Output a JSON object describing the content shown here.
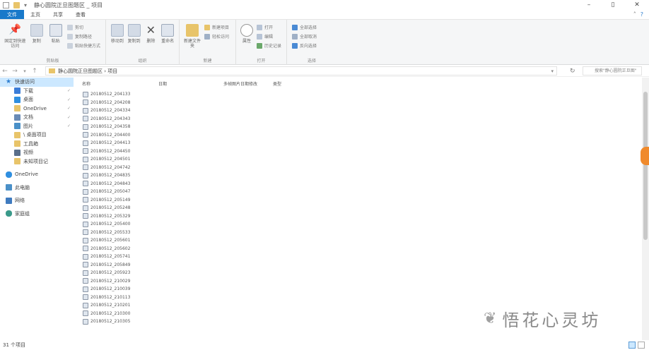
{
  "titlebar": {
    "title": "静心圆院正旦图题区 _ 项目",
    "controls": [
      "–",
      "▯",
      "✕"
    ]
  },
  "ribbon_tabs": [
    {
      "label": "文件",
      "active": true
    },
    {
      "label": "主页"
    },
    {
      "label": "共享"
    },
    {
      "label": "查看"
    }
  ],
  "ribbon": {
    "clipboard": {
      "label": "剪贴板",
      "pin_label": "固定到快速访问",
      "copy_label": "复制",
      "paste_label": "粘贴",
      "cut_label": "剪切",
      "copy_path_label": "复制路径",
      "paste_shortcut_label": "粘贴快捷方式"
    },
    "organize": {
      "label": "组织",
      "move_label": "移动到",
      "copy_to_label": "复制到",
      "delete_label": "删除",
      "rename_label": "重命名"
    },
    "new": {
      "label": "新建",
      "new_folder_label": "新建文件夹",
      "new_item_label": "新建项目",
      "easy_access_label": "轻松访问"
    },
    "open": {
      "label": "打开",
      "properties_label": "属性",
      "open_label": "打开",
      "edit_label": "编辑",
      "history_label": "历史记录"
    },
    "select": {
      "label": "选择",
      "select_all_label": "全部选择",
      "select_none_label": "全部取消",
      "invert_label": "反向选择"
    }
  },
  "address": {
    "path": "静心圆院正旦图题区 › 项目",
    "search_placeholder": "搜索\"静心圆院正旦图\""
  },
  "nav": {
    "quick_access": "快速访问",
    "items": [
      {
        "label": "下载",
        "icon": "download-icon",
        "color": "#3b7dd8",
        "pinned": true
      },
      {
        "label": "桌面",
        "icon": "desktop-icon",
        "color": "#2f8fe0",
        "pinned": true
      },
      {
        "label": "OneDrive",
        "icon": "folder-icon",
        "color": "#e8c46a",
        "pinned": true
      },
      {
        "label": "文档",
        "icon": "documents-icon",
        "color": "#6a8bb5",
        "pinned": true
      },
      {
        "label": "图片",
        "icon": "pictures-icon",
        "color": "#4a90c8",
        "pinned": true
      },
      {
        "label": "\\ 桌面项目",
        "icon": "folder-icon",
        "color": "#e8c46a",
        "pinned": false
      },
      {
        "label": "工具箱",
        "icon": "folder-icon",
        "color": "#e8c46a",
        "pinned": false
      },
      {
        "label": "视频",
        "icon": "videos-icon",
        "color": "#5a6f8a",
        "pinned": false
      },
      {
        "label": "未知项目记",
        "icon": "folder-icon",
        "color": "#e8c46a",
        "pinned": false
      }
    ],
    "onedrive": "OneDrive",
    "this_pc": "此电脑",
    "network": "网络",
    "homegroup": "家庭组"
  },
  "columns": {
    "name": "名称",
    "date": "日期",
    "size": "多帧图片日期修改",
    "type": "类型"
  },
  "files": [
    "20180512_204133",
    "20180512_204208",
    "20180512_204334",
    "20180512_204343",
    "20180512_204358",
    "20180512_204400",
    "20180512_204413",
    "20180512_204450",
    "20180512_204501",
    "20180512_204742",
    "20180512_204835",
    "20180512_204843",
    "20180512_205047",
    "20180512_205149",
    "20180512_205248",
    "20180512_205329",
    "20180512_205400",
    "20180512_205533",
    "20180512_205601",
    "20180512_205602",
    "20180512_205741",
    "20180512_205849",
    "20180512_205923",
    "20180512_210029",
    "20180512_210039",
    "20180512_210113",
    "20180512_210201",
    "20180512_210300",
    "20180512_210305"
  ],
  "status": {
    "count": "31 个项目"
  },
  "watermark": {
    "logo": "❦",
    "text": "悟花心灵坊"
  }
}
